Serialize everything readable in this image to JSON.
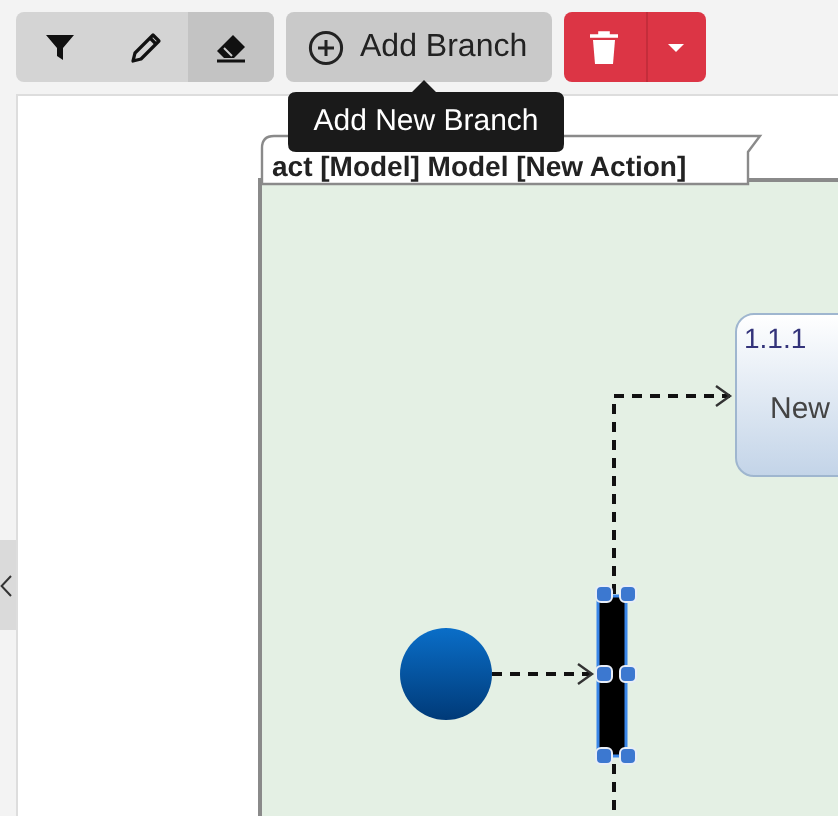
{
  "toolbar": {
    "tools": [
      {
        "kind": "filter",
        "selected": false
      },
      {
        "kind": "pencil",
        "selected": false
      },
      {
        "kind": "eraser",
        "selected": true
      }
    ],
    "add_button": {
      "label": "Add Branch"
    }
  },
  "tooltip": {
    "text": "Add New Branch"
  },
  "diagram": {
    "frame_title": "act [Model] Model [New Action]",
    "nodes": [
      {
        "kind": "initial"
      },
      {
        "kind": "fork",
        "selected": true
      },
      {
        "kind": "action",
        "number": "1.1.1",
        "label": "New"
      }
    ]
  }
}
